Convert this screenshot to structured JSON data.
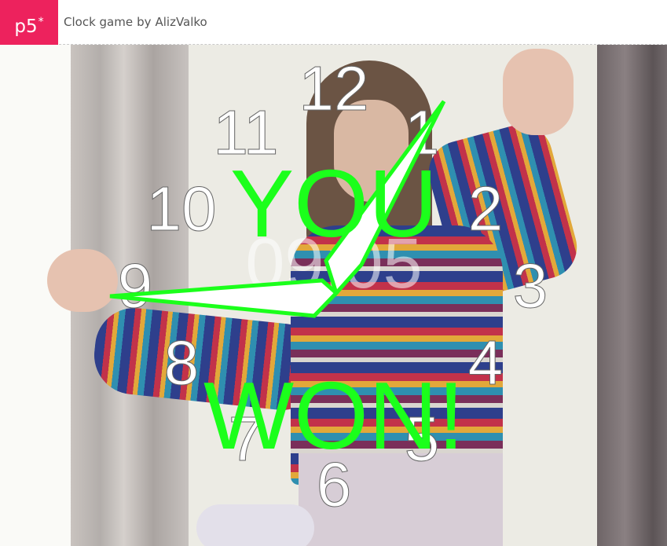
{
  "header": {
    "logo_text": "p5",
    "logo_star": "*",
    "sketch_name": "Clock game",
    "by_label": "by",
    "author": "AlizValko"
  },
  "game": {
    "clock_numbers": [
      "12",
      "1",
      "2",
      "3",
      "4",
      "5",
      "6",
      "7",
      "8",
      "9",
      "10",
      "11"
    ],
    "digital_time": "09:05",
    "message_line1": "YOU",
    "message_line2": "WON!"
  },
  "colors": {
    "brand": "#ed225d",
    "win_text": "#1bff1b",
    "hand_outline": "#1bff1b"
  }
}
